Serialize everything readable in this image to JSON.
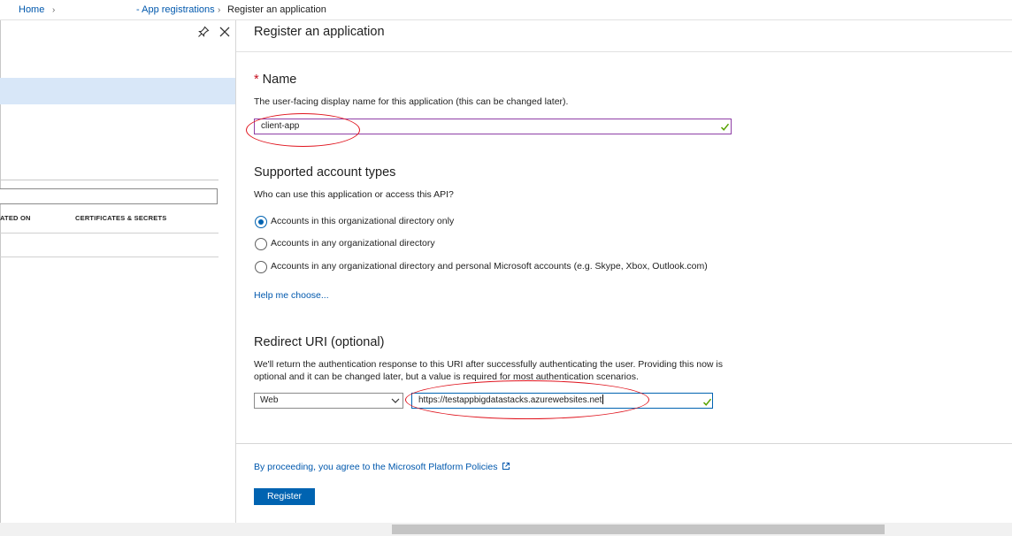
{
  "breadcrumb": {
    "home": "Home",
    "app_registrations": "- App registrations",
    "current": "Register an application"
  },
  "left_panel": {
    "columns": [
      "ATED ON",
      "CERTIFICATES & SECRETS"
    ]
  },
  "main": {
    "title": "Register an application",
    "name_section": {
      "required_marker": "*",
      "heading": "Name",
      "description": "The user-facing display name for this application (this can be changed later).",
      "value": "client-app"
    },
    "account_types": {
      "heading": "Supported account types",
      "description": "Who can use this application or access this API?",
      "options": [
        {
          "label": "Accounts in this organizational directory only",
          "selected": true
        },
        {
          "label": "Accounts in any organizational directory",
          "selected": false
        },
        {
          "label": "Accounts in any organizational directory and personal Microsoft accounts (e.g. Skype, Xbox, Outlook.com)",
          "selected": false
        }
      ],
      "help_link": "Help me choose..."
    },
    "redirect": {
      "heading": "Redirect URI (optional)",
      "description": "We'll return the authentication response to this URI after successfully authenticating the user. Providing this now is optional and it can be changed later, but a value is required for most authentication scenarios.",
      "platform": "Web",
      "uri": "https://testappbigdatastacks.azurewebsites.net"
    },
    "policy_link": "By proceeding, you agree to the Microsoft Platform Policies",
    "register_label": "Register"
  },
  "colors": {
    "accent": "#0063b1",
    "link": "#0058ad",
    "annotation": "#e0141e",
    "valid_check": "#57a300"
  },
  "icons": [
    "pin-icon",
    "close-icon",
    "checkmark-icon",
    "chevron-down-icon",
    "external-link-icon"
  ]
}
